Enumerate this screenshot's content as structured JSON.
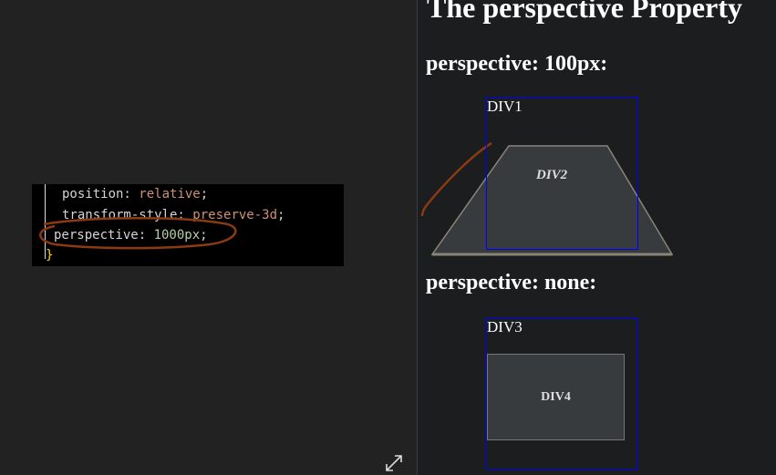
{
  "code": {
    "line1_prop": "position: ",
    "line1_val": "relative",
    "line2_prop": "transform-style: ",
    "line2_val": "preserve-3d",
    "line3_prop": "perspective: ",
    "line3_val": "1000px",
    "semicolon": ";",
    "closing_brace": "}"
  },
  "preview": {
    "title": "The perspective Property",
    "heading1": "perspective: 100px:",
    "div1": "DIV1",
    "div2": "DIV2",
    "heading2": "perspective: none:",
    "div3": "DIV3",
    "div4": "DIV4"
  },
  "colors": {
    "annotation": "#8b3a12",
    "border": "#0000ff"
  }
}
